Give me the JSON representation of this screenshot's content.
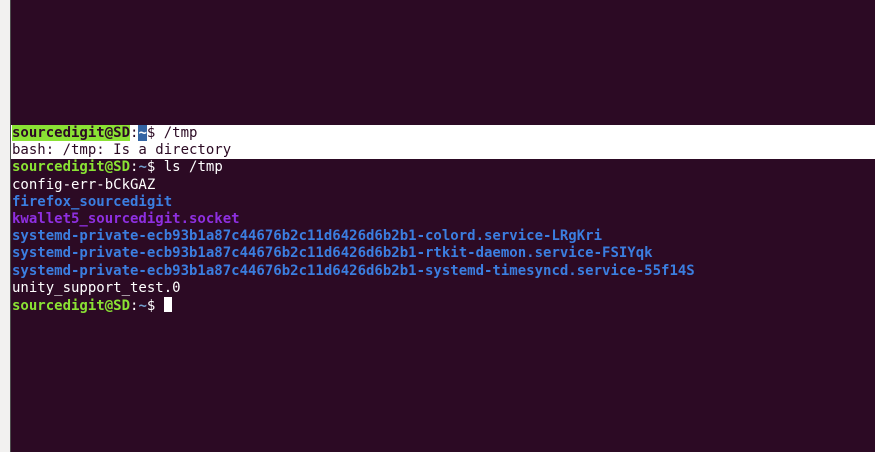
{
  "terminal": {
    "colors": {
      "background": "#2c0a24",
      "prompt_user": "#8ae234",
      "prompt_path": "#729fcf",
      "directory": "#3b7ee0",
      "socket": "#8e2fe0",
      "text": "#ffffff"
    },
    "prompt": {
      "user_host": "sourcedigit@SD",
      "colon": ":",
      "path": "~",
      "symbol": "$ "
    },
    "lines": [
      {
        "command": "/tmp"
      },
      {
        "output": "bash: /tmp: Is a directory"
      },
      {
        "command": "ls /tmp"
      }
    ],
    "listing": [
      {
        "name": "config-err-bCkGAZ",
        "kind": "file"
      },
      {
        "name": "firefox_sourcedigit",
        "kind": "directory"
      },
      {
        "name": "kwallet5_sourcedigit.socket",
        "kind": "socket"
      },
      {
        "name": "systemd-private-ecb93b1a87c44676b2c11d6426d6b2b1-colord.service-LRgKri",
        "kind": "directory"
      },
      {
        "name": "systemd-private-ecb93b1a87c44676b2c11d6426d6b2b1-rtkit-daemon.service-FSIYqk",
        "kind": "directory"
      },
      {
        "name": "systemd-private-ecb93b1a87c44676b2c11d6426d6b2b1-systemd-timesyncd.service-55f14S",
        "kind": "directory"
      },
      {
        "name": "unity_support_test.0",
        "kind": "file"
      }
    ]
  }
}
